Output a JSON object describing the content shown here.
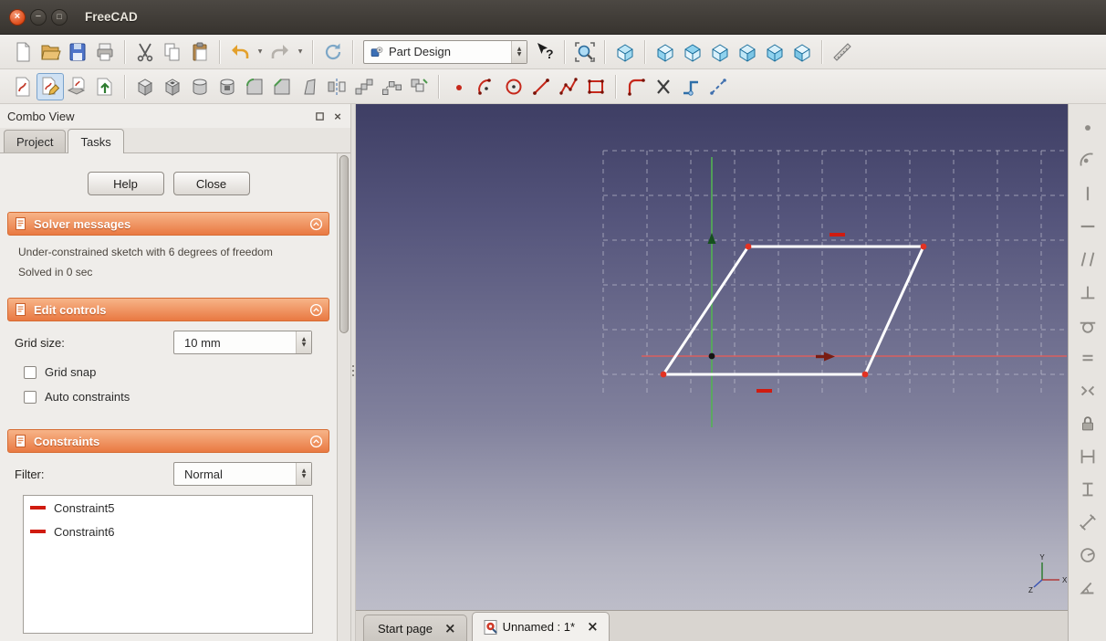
{
  "window": {
    "title": "FreeCAD",
    "controls": {
      "close": "×",
      "minimize": "−",
      "maximize": "□"
    }
  },
  "toolbars": {
    "workbench_selected": "Part Design"
  },
  "glyphs": {
    "spin_up": "▲",
    "spin_down": "▼",
    "dropdown_caret": "▼",
    "panel_close": "×",
    "tab_close": "×"
  },
  "combo_view": {
    "title": "Combo View",
    "tabs": {
      "project": "Project",
      "tasks": "Tasks"
    },
    "active_tab": "Tasks",
    "task_buttons": {
      "help": "Help",
      "close": "Close"
    },
    "solver": {
      "title": "Solver messages",
      "message": "Under-constrained sketch with 6 degrees of freedom",
      "status": "Solved in 0 sec"
    },
    "edit_controls": {
      "title": "Edit controls",
      "grid_size_label": "Grid size:",
      "grid_size_value": "10 mm",
      "grid_snap_label": "Grid snap",
      "grid_snap_checked": false,
      "auto_constraints_label": "Auto constraints",
      "auto_constraints_checked": false
    },
    "constraints": {
      "title": "Constraints",
      "filter_label": "Filter:",
      "filter_value": "Normal",
      "items": [
        {
          "label": "Constraint5"
        },
        {
          "label": "Constraint6"
        }
      ]
    }
  },
  "document_tabs": {
    "start": "Start page",
    "unnamed": "Unnamed : 1*"
  },
  "viewport": {
    "axis_labels": {
      "x": "X",
      "y": "Y",
      "z": "Z"
    }
  },
  "colors": {
    "task_header_orange": "#e97942",
    "viewport_top": "#3e3e64",
    "viewport_bottom": "#bdbdc9",
    "sketch_line": "#ffffff",
    "sketch_vertex_red": "#e23222",
    "constraint_red": "#d01b10",
    "axis_x": "#d95f5f",
    "axis_y": "#53b353",
    "titlebar_close": "#dd4814"
  }
}
